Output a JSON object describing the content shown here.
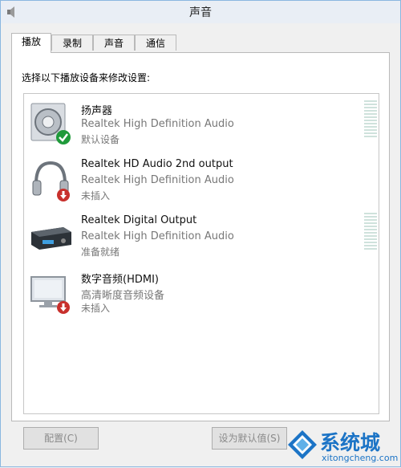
{
  "window": {
    "title": "声音"
  },
  "tabs": [
    {
      "label": "播放",
      "active": true
    },
    {
      "label": "录制",
      "active": false
    },
    {
      "label": "声音",
      "active": false
    },
    {
      "label": "通信",
      "active": false
    }
  ],
  "playback": {
    "instruction": "选择以下播放设备来修改设置:",
    "devices": [
      {
        "name": "扬声器",
        "description": "Realtek High Definition Audio",
        "status": "默认设备",
        "icon": "speaker-icon",
        "badge": "default-check-icon",
        "meter": true
      },
      {
        "name": "Realtek HD Audio 2nd output",
        "description": "Realtek High Definition Audio",
        "status": "未插入",
        "icon": "headphones-icon",
        "badge": "unplugged-icon",
        "meter": false
      },
      {
        "name": "Realtek Digital Output",
        "description": "Realtek High Definition Audio",
        "status": "准备就绪",
        "icon": "digital-output-icon",
        "badge": "",
        "meter": true
      },
      {
        "name": "数字音频(HDMI)",
        "description": "高清晰度音频设备",
        "status": "未插入",
        "icon": "monitor-icon",
        "badge": "unplugged-icon",
        "meter": false
      }
    ]
  },
  "buttons": {
    "configure": "配置(C)",
    "set_default": "设为默认值(S)"
  },
  "watermark": {
    "brand": "系统城",
    "url": "xitongcheng.com"
  },
  "colors": {
    "accent": "#1c74c6",
    "default_check": "#1f9a3a",
    "unplugged": "#c8302c"
  }
}
